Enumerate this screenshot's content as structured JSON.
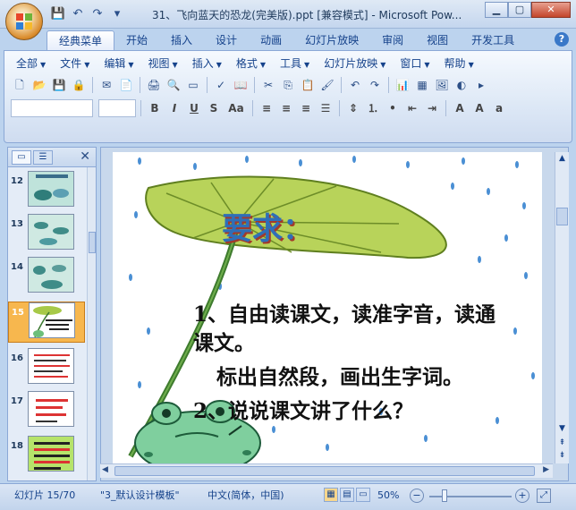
{
  "window": {
    "title": "31、飞向蓝天的恐龙(完美版).ppt [兼容模式] - Microsoft Pow...",
    "minimize": "▁",
    "restore": "▢",
    "close": "✕"
  },
  "tabs": [
    "经典菜单",
    "开始",
    "插入",
    "设计",
    "动画",
    "幻灯片放映",
    "审阅",
    "视图",
    "开发工具"
  ],
  "menus": [
    "全部",
    "文件",
    "编辑",
    "视图",
    "插入",
    "格式",
    "工具",
    "幻灯片放映",
    "窗口",
    "帮助"
  ],
  "thumbnails": [
    {
      "num": "12"
    },
    {
      "num": "13"
    },
    {
      "num": "14"
    },
    {
      "num": "15",
      "selected": true
    },
    {
      "num": "16"
    },
    {
      "num": "17"
    },
    {
      "num": "18"
    }
  ],
  "slide": {
    "heading": "要求：",
    "line1": "1、自由读课文，读准字音，读通",
    "line2": "课文。",
    "line3": "标出自然段，画出生字词。",
    "line4": "2、说说课文讲了什么？"
  },
  "status": {
    "slide": "幻灯片 15/70",
    "template": "\"3_默认设计模板\"",
    "lang": "中文(简体，中国)",
    "zoom": "50%"
  },
  "colors": {
    "accent": "#15428b",
    "selected": "#f7b74e"
  }
}
